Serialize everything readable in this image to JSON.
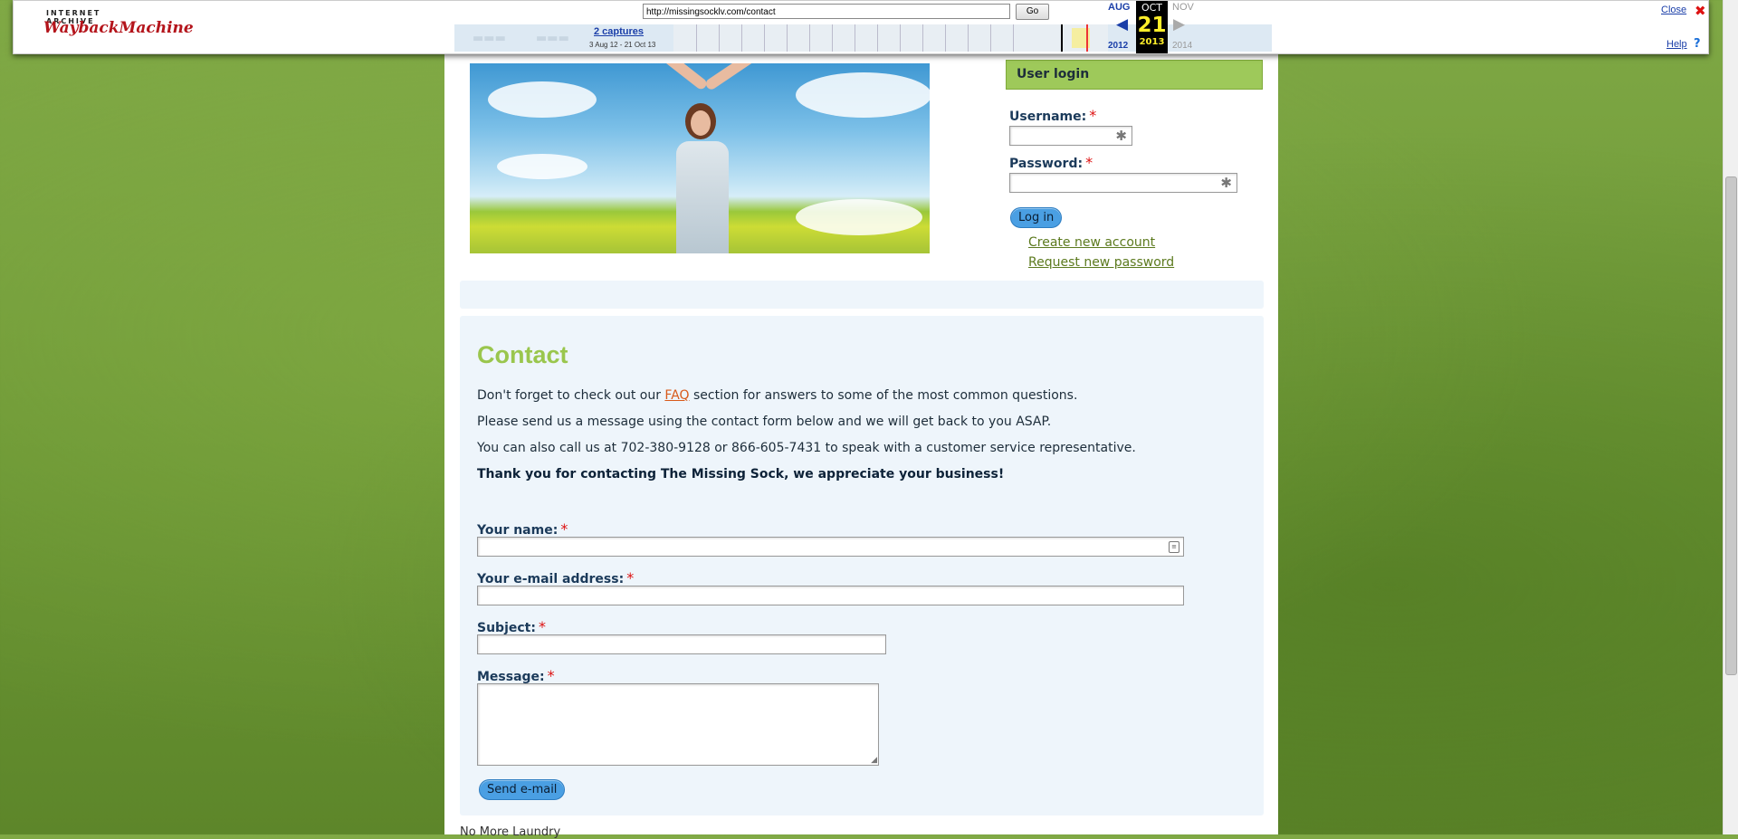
{
  "wayback": {
    "logo_top": "INTERNET ARCHIVE",
    "logo_main": "WaybackMachine",
    "url": "http://missingsocklv.com/contact",
    "go_label": "Go",
    "captures_link": "2 captures",
    "captures_range": "3 Aug 12 - 21 Oct 13",
    "prev_month": "AUG",
    "prev_year": "2012",
    "cur_month": "OCT",
    "cur_day": "21",
    "cur_year": "2013",
    "next_month": "NOV",
    "next_year": "2014",
    "close_label": "Close",
    "help_label": "Help"
  },
  "login": {
    "title": "User login",
    "username_label": "Username:",
    "password_label": "Password:",
    "required_mark": "*",
    "login_button": "Log in",
    "create_account_link": "Create new account",
    "request_password_link": "Request new password"
  },
  "contact": {
    "title": "Contact",
    "para1_pre": "Don't forget to check out our ",
    "para1_link": "FAQ",
    "para1_post": " section for answers to some of the most common questions.",
    "para2": "Please send us a message using the contact form below and we will get back to you ASAP.",
    "para3": "You can also call us at 702-380-9128 or 866-605-7431 to speak with a customer service representative.",
    "para4": "Thank you for contacting The Missing Sock, we appreciate your business!",
    "name_label": "Your name:",
    "email_label": "Your e-mail address:",
    "subject_label": "Subject:",
    "message_label": "Message:",
    "send_button": "Send e-mail"
  },
  "footer": {
    "text": "No More Laundry"
  }
}
